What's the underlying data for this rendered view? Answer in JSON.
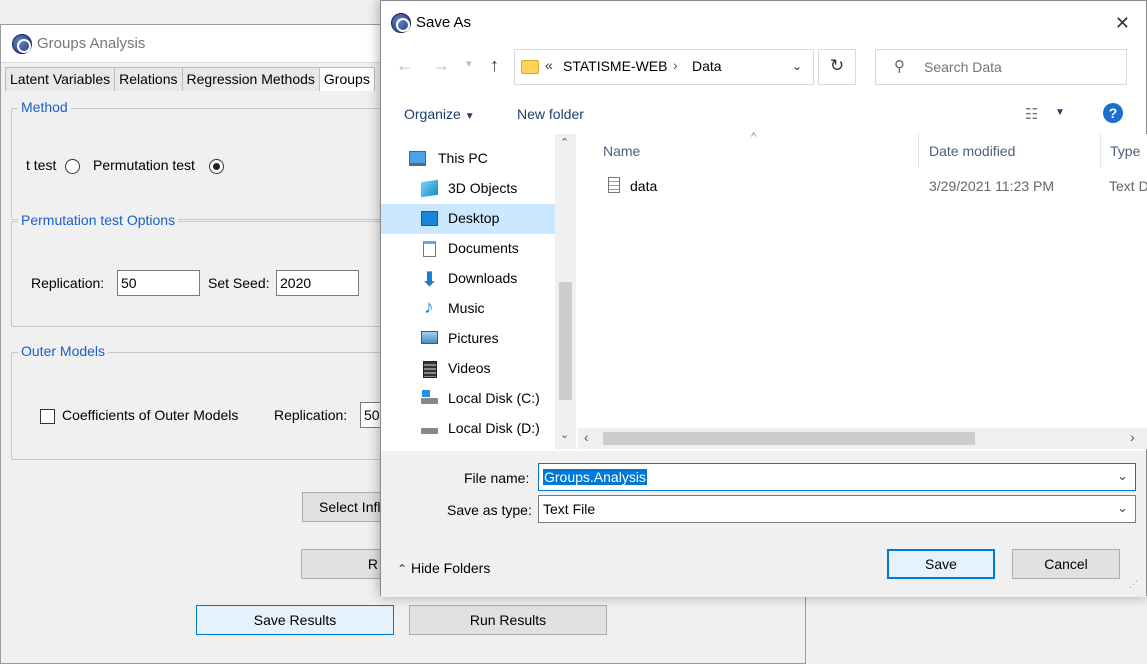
{
  "background_window": {
    "title": "Groups Analysis",
    "tabs": [
      "Latent Variables",
      "Relations",
      "Regression Methods",
      "Groups"
    ],
    "method": {
      "legend": "Method",
      "option_t_test": "t test",
      "option_permutation": "Permutation test",
      "selected": "Permutation test"
    },
    "permutation_options": {
      "legend": "Permutation test Options",
      "replication_label": "Replication:",
      "replication_value": "50",
      "seed_label": "Set Seed:",
      "seed_value": "2020"
    },
    "outer_models": {
      "legend": "Outer Models",
      "checkbox_label": "Coefficients of Outer Models",
      "checked": false,
      "replication_label": "Replication:",
      "replication_value": "50"
    },
    "buttons": {
      "select_influential": "Select Infl",
      "r_partial": "R",
      "save_results": "Save Results",
      "run_results": "Run Results"
    }
  },
  "dialog": {
    "title": "Save As",
    "close": "✕",
    "address": {
      "prefix": "«",
      "segments": [
        "STATISME-WEB",
        "Data"
      ]
    },
    "search_placeholder": "Search Data",
    "toolbar": {
      "organize": "Organize",
      "new_folder": "New folder",
      "help": "?"
    },
    "nav_items": [
      {
        "label": "This PC",
        "icon": "pc-icon"
      },
      {
        "label": "3D Objects",
        "icon": "cube-icon"
      },
      {
        "label": "Desktop",
        "icon": "desktop-icon",
        "selected": true
      },
      {
        "label": "Documents",
        "icon": "document-icon"
      },
      {
        "label": "Downloads",
        "icon": "download-arrow-icon"
      },
      {
        "label": "Music",
        "icon": "music-note-icon"
      },
      {
        "label": "Pictures",
        "icon": "picture-icon"
      },
      {
        "label": "Videos",
        "icon": "film-icon"
      },
      {
        "label": "Local Disk (C:)",
        "icon": "drive-c-icon"
      },
      {
        "label": "Local Disk (D:)",
        "icon": "drive-icon"
      }
    ],
    "columns": [
      "Name",
      "Date modified",
      "Type"
    ],
    "files": [
      {
        "name": "data",
        "date": "3/29/2021 11:23 PM",
        "type": "Text D"
      }
    ],
    "file_name_label": "File name:",
    "file_name_value": "Groups.Analysis",
    "save_type_label": "Save as type:",
    "save_type_value": "Text File",
    "hide_folders": "Hide Folders",
    "save_button": "Save",
    "cancel_button": "Cancel"
  }
}
